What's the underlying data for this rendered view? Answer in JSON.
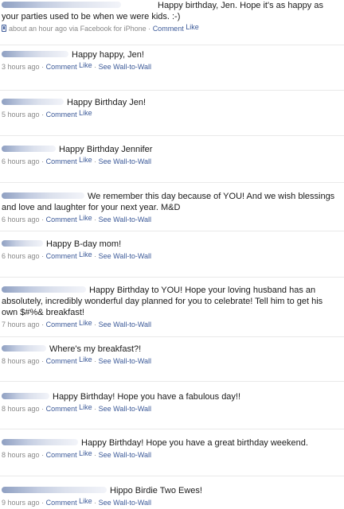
{
  "posts": [
    {
      "message": "Happy birthday, Jen. Hope it's as happy as your parties used to be when we were kids. :-)",
      "time": "about an hour ago",
      "via": "via Facebook for iPhone",
      "comment": "Comment",
      "like": "Like",
      "wall": ""
    },
    {
      "message": "Happy happy, Jen!",
      "time": "3 hours ago",
      "via": "",
      "comment": "Comment",
      "like": "Like",
      "wall": "See Wall-to-Wall"
    },
    {
      "message": "Happy Birthday Jen!",
      "time": "5 hours ago",
      "via": "",
      "comment": "Comment",
      "like": "Like",
      "wall": ""
    },
    {
      "message": "Happy Birthday Jennifer",
      "time": "6 hours ago",
      "via": "",
      "comment": "Comment",
      "like": "Like",
      "wall": "See Wall-to-Wall"
    },
    {
      "message": "We remember this day because of YOU! And we wish blessings and love and laughter for your next year. M&D",
      "time": "6 hours ago",
      "via": "",
      "comment": "Comment",
      "like": "Like",
      "wall": "See Wall-to-Wall"
    },
    {
      "message": "Happy B-day mom!",
      "time": "6 hours ago",
      "via": "",
      "comment": "Comment",
      "like": "Like",
      "wall": "See Wall-to-Wall"
    },
    {
      "message": "Happy Birthday to YOU! Hope your loving husband has an absolutely, incredibly wonderful day planned for you to celebrate! Tell him to get his own $#%& breakfast!",
      "time": "7 hours ago",
      "via": "",
      "comment": "Comment",
      "like": "Like",
      "wall": "See Wall-to-Wall"
    },
    {
      "message": "Where's my breakfast?!",
      "time": "8 hours ago",
      "via": "",
      "comment": "Comment",
      "like": "Like",
      "wall": "See Wall-to-Wall"
    },
    {
      "message": "Happy Birthday! Hope you have a fabulous day!!",
      "time": "8 hours ago",
      "via": "",
      "comment": "Comment",
      "like": "Like",
      "wall": "See Wall-to-Wall"
    },
    {
      "message": "Happy Birthday! Hope you have a great birthday weekend.",
      "time": "8 hours ago",
      "via": "",
      "comment": "Comment",
      "like": "Like",
      "wall": "See Wall-to-Wall"
    },
    {
      "message": "Hippo Birdie Two Ewes!",
      "time": "9 hours ago",
      "via": "",
      "comment": "Comment",
      "like": "Like",
      "wall": "See Wall-to-Wall"
    }
  ],
  "icons": {
    "via_icon": "phone-icon"
  },
  "colors": {
    "link": "#3b5998",
    "meta": "#888888",
    "text": "#1a1a1a"
  }
}
